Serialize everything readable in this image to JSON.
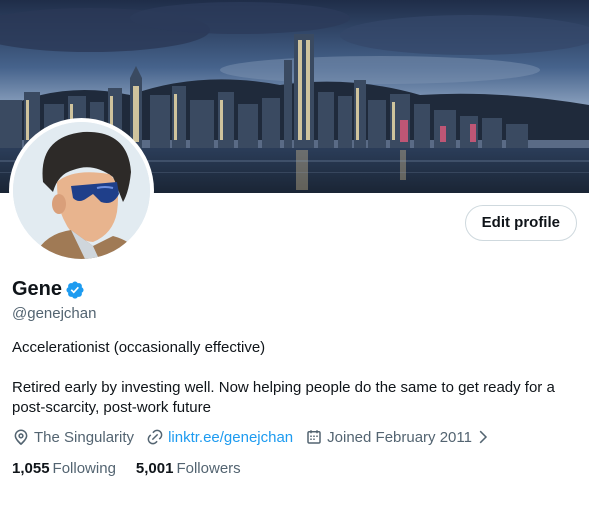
{
  "profile": {
    "name": "Gene",
    "handle": "@genejchan",
    "bio_line1": "Accelerationist (occasionally effective)",
    "bio_line2": "Retired early by investing well. Now helping people do the same to get ready for a post-scarcity, post-work future",
    "location": "The Singularity",
    "link": "linktr.ee/genejchan",
    "joined": "Joined February 2011",
    "following_count": "1,055",
    "following_label": "Following",
    "followers_count": "5,001",
    "followers_label": "Followers"
  },
  "actions": {
    "edit_profile_label": "Edit profile"
  },
  "icons": {
    "verified": "verified-badge-icon",
    "location": "location-pin-icon",
    "link": "link-icon",
    "calendar": "calendar-icon",
    "chevron": "chevron-right-icon"
  },
  "colors": {
    "accent": "#1d9bf0",
    "text_primary": "#0f1419",
    "text_secondary": "#536471",
    "border": "#cfd9de"
  }
}
